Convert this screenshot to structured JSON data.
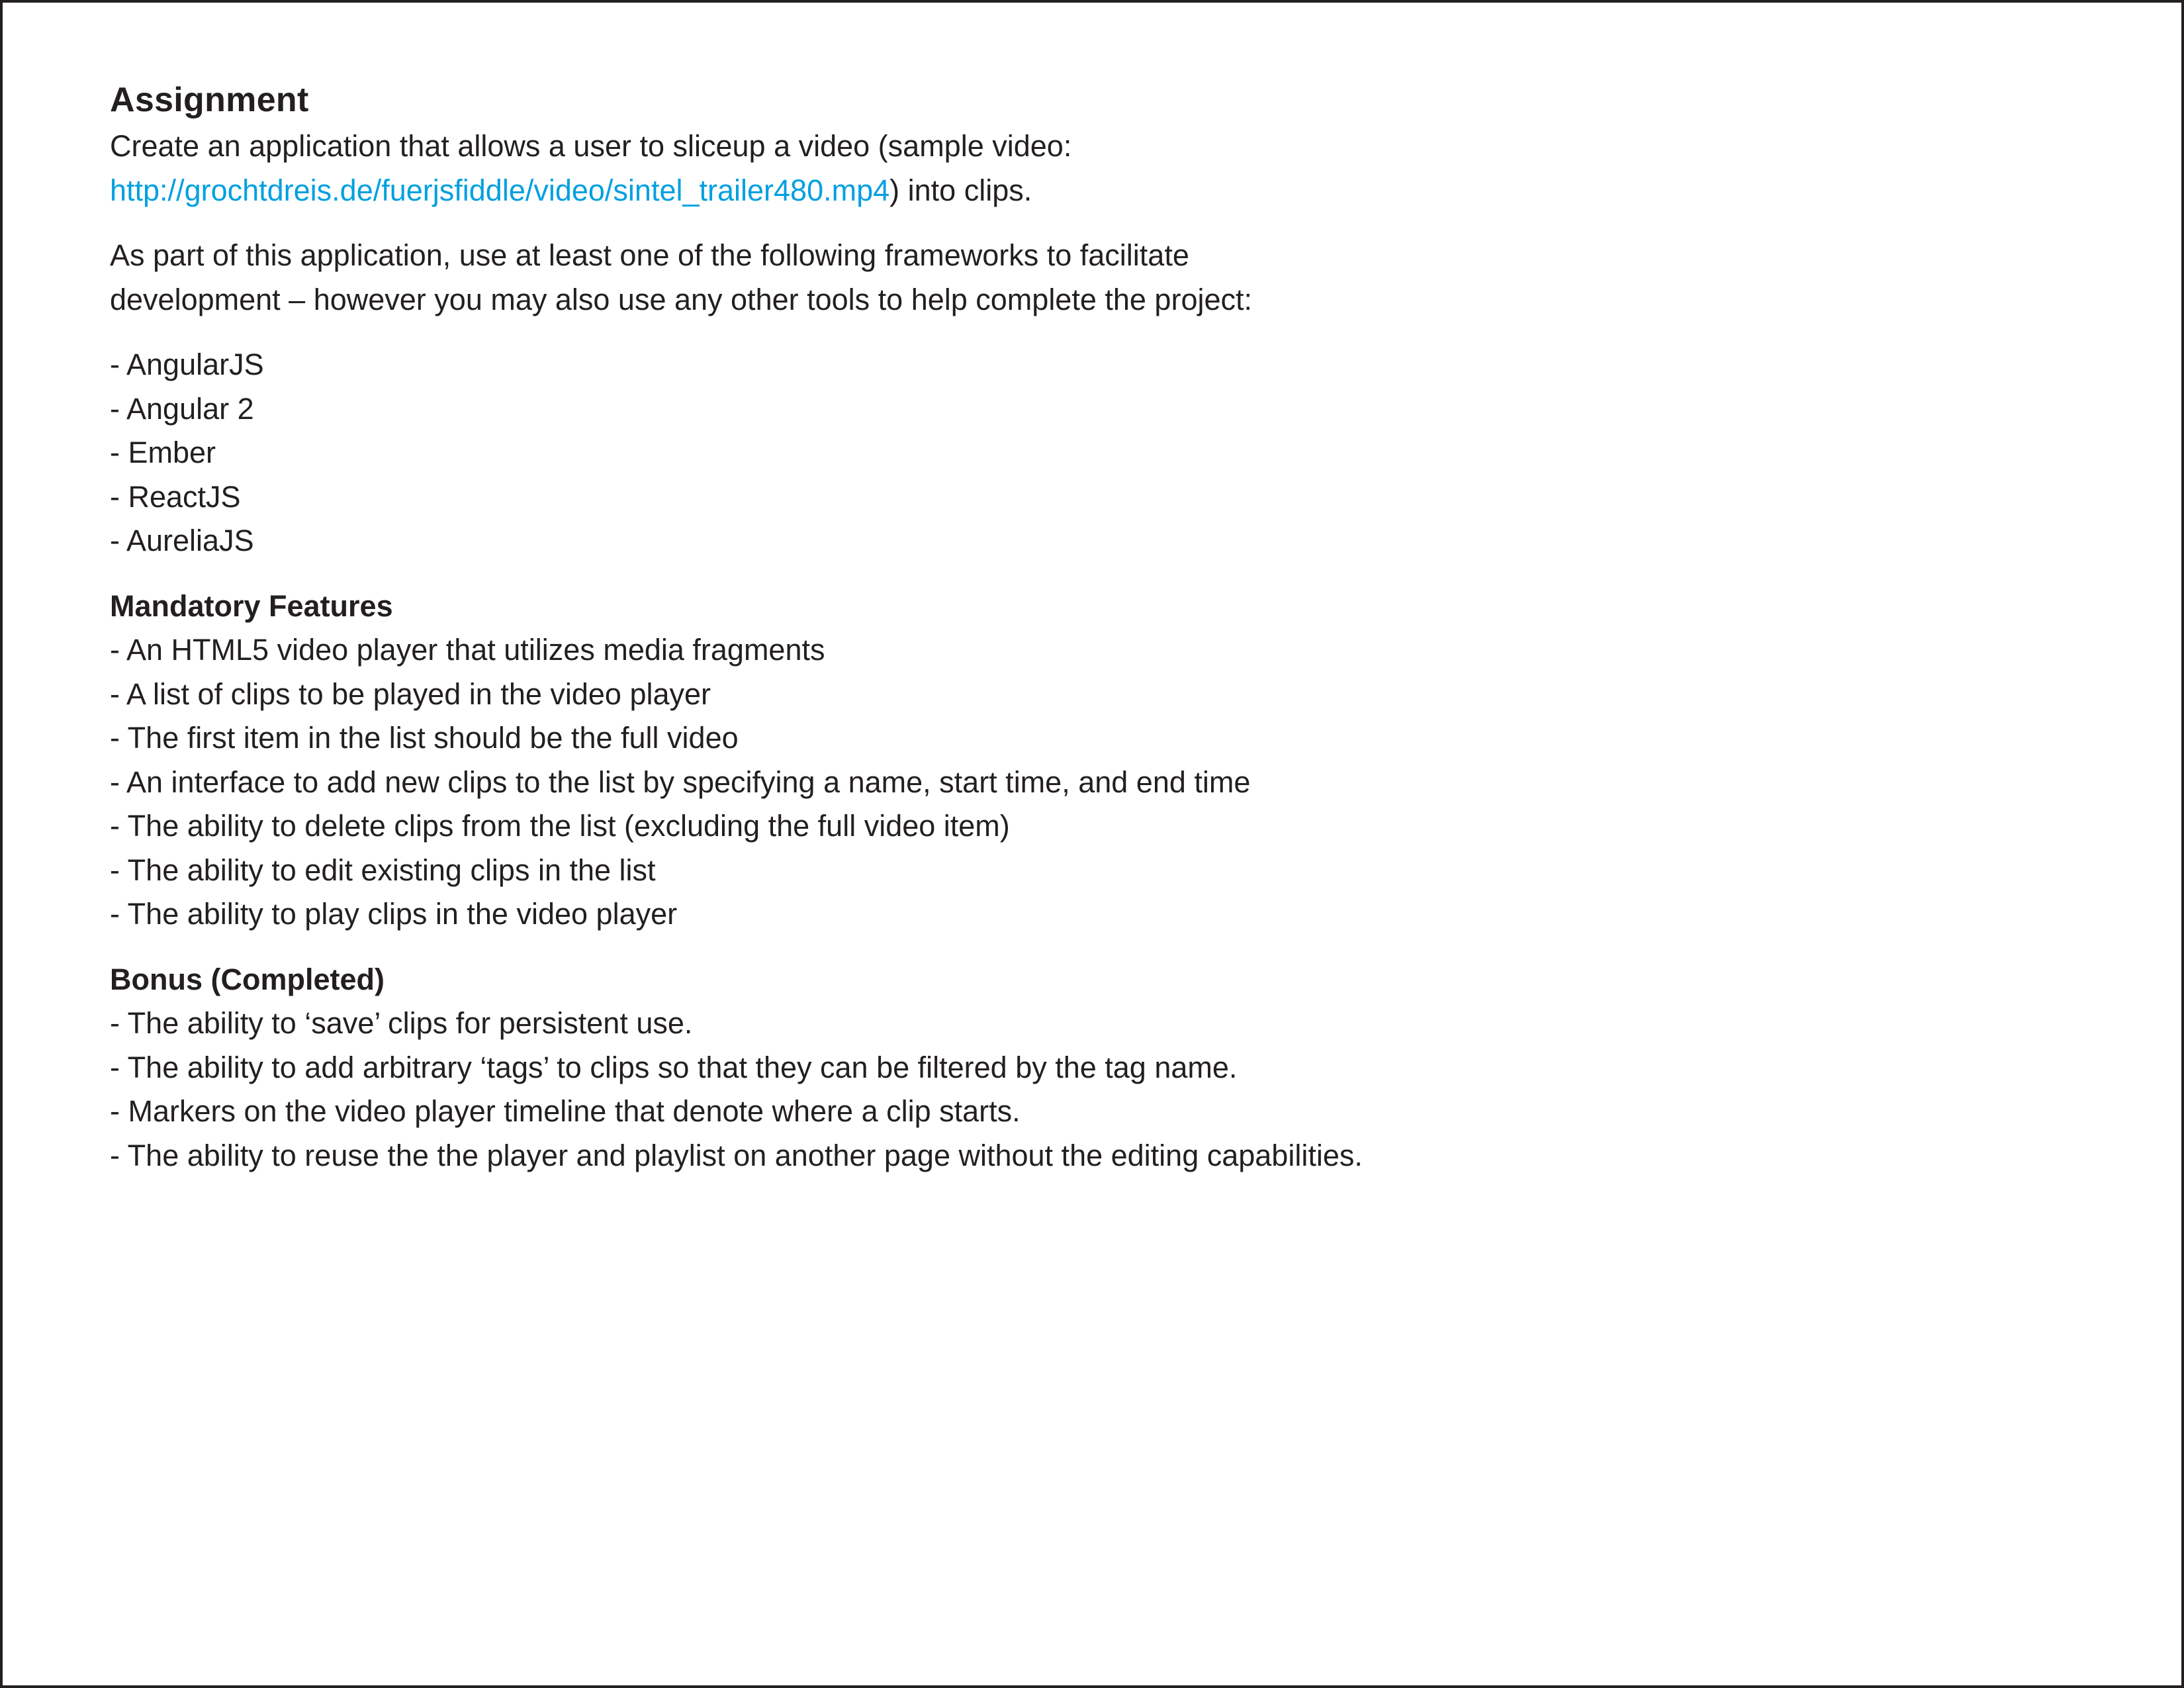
{
  "title": "Assignment",
  "intro": {
    "line1": "Create an application that allows a user to sliceup a video (sample video:",
    "link": "http://grochtdreis.de/fuerjsfiddle/video/sintel_trailer480.mp4",
    "line2_suffix": ") into clips."
  },
  "frameworks_intro": {
    "line1": "As part of this application, use at least one of the following frameworks to facilitate",
    "line2": "development – however you may also use any other tools to help complete the project:"
  },
  "frameworks": [
    "- AngularJS",
    "- Angular 2",
    "- Ember",
    "- ReactJS",
    "- AureliaJS"
  ],
  "mandatory": {
    "heading": "Mandatory Features",
    "items": [
      "- An HTML5 video player that utilizes media fragments",
      "- A list of clips to be played in the video player",
      "- The first item in the list should be the full video",
      "- An interface to add new clips to the list by specifying a name, start time, and end time",
      "- The ability to delete clips from the list (excluding the full video item)",
      "- The ability to edit existing clips in the list",
      "- The ability to play clips in the video player"
    ]
  },
  "bonus": {
    "heading": "Bonus (Completed)",
    "items": [
      "- The ability to ‘save’ clips for persistent use.",
      "- The ability to add arbitrary ‘tags’ to clips so that they can be filtered by the tag name.",
      "- Markers on the video player timeline that denote where a clip starts.",
      "- The ability to reuse the the player and playlist on another page without the editing capabilities."
    ]
  },
  "colors": {
    "text": "#231f20",
    "link": "#00a0e0",
    "border": "#231f20"
  }
}
